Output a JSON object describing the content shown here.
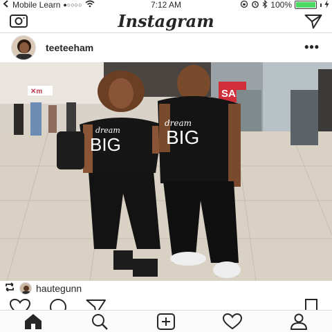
{
  "status_bar": {
    "carrier": "Mobile Learn",
    "time": "7:12 AM",
    "battery": "100%"
  },
  "header": {
    "title": "Instagram"
  },
  "post": {
    "username": "teeteeham",
    "more_label": "•••",
    "shirt_text_script": "dream",
    "shirt_text_big": "BIG",
    "store_sign": "SAL",
    "regram": {
      "username": "hautegunn"
    }
  },
  "tab_bar": {
    "items": [
      "home-icon",
      "search-icon",
      "add-post-icon",
      "activity-heart-icon",
      "profile-icon"
    ],
    "active": "home-icon"
  },
  "colors": {
    "battery_green": "#4cd964",
    "text": "#262626",
    "border": "#dbdbdb"
  }
}
